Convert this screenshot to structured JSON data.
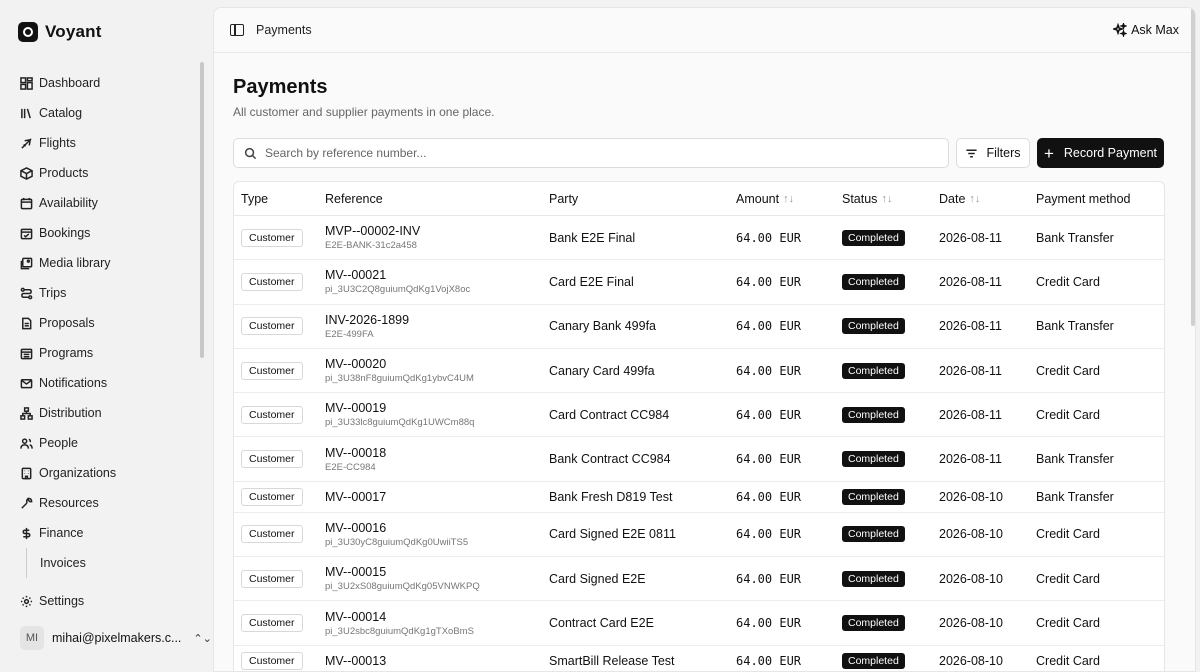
{
  "brand": {
    "name": "Voyant"
  },
  "sidebar": {
    "items": [
      {
        "label": "Dashboard",
        "icon": "dashboard-icon"
      },
      {
        "label": "Catalog",
        "icon": "catalog-icon"
      },
      {
        "label": "Flights",
        "icon": "plane-icon"
      },
      {
        "label": "Products",
        "icon": "box-icon"
      },
      {
        "label": "Availability",
        "icon": "calendar-icon"
      },
      {
        "label": "Bookings",
        "icon": "calendar-check-icon"
      },
      {
        "label": "Media library",
        "icon": "image-icon"
      },
      {
        "label": "Trips",
        "icon": "route-icon"
      },
      {
        "label": "Proposals",
        "icon": "document-icon"
      },
      {
        "label": "Programs",
        "icon": "calendar-grid-icon"
      },
      {
        "label": "Notifications",
        "icon": "mail-icon"
      },
      {
        "label": "Distribution",
        "icon": "network-icon"
      },
      {
        "label": "People",
        "icon": "people-icon"
      },
      {
        "label": "Organizations",
        "icon": "building-icon"
      },
      {
        "label": "Resources",
        "icon": "wrench-icon"
      },
      {
        "label": "Finance",
        "icon": "dollar-icon"
      }
    ],
    "subitem": "Invoices",
    "settings": "Settings",
    "user": {
      "initials": "MI",
      "email": "mihai@pixelmakers.c...",
      "chevron": "⌃⌄"
    }
  },
  "topbar": {
    "breadcrumb": "Payments",
    "ask_label": "Ask Max"
  },
  "page": {
    "title": "Payments",
    "subtitle": "All customer and supplier payments in one place.",
    "search_placeholder": "Search by reference number...",
    "filters_label": "Filters",
    "record_label": "Record Payment"
  },
  "table": {
    "headers": {
      "type": "Type",
      "reference": "Reference",
      "party": "Party",
      "amount": "Amount",
      "status": "Status",
      "date": "Date",
      "method": "Payment method"
    },
    "sort_glyph": "↑↓",
    "rows": [
      {
        "type": "Customer",
        "ref": "MVP--00002-INV",
        "sub": "E2E-BANK-31c2a458",
        "party": "Bank E2E Final",
        "amount": "64.00 EUR",
        "status": "Completed",
        "date": "2026-08-11",
        "method": "Bank Transfer"
      },
      {
        "type": "Customer",
        "ref": "MV--00021",
        "sub": "pi_3U3C2Q8guiumQdKg1VojX8oc",
        "party": "Card E2E Final",
        "amount": "64.00 EUR",
        "status": "Completed",
        "date": "2026-08-11",
        "method": "Credit Card"
      },
      {
        "type": "Customer",
        "ref": "INV-2026-1899",
        "sub": "E2E-499FA",
        "party": "Canary Bank 499fa",
        "amount": "64.00 EUR",
        "status": "Completed",
        "date": "2026-08-11",
        "method": "Bank Transfer"
      },
      {
        "type": "Customer",
        "ref": "MV--00020",
        "sub": "pi_3U38nF8guiumQdKg1ybvC4UM",
        "party": "Canary Card 499fa",
        "amount": "64.00 EUR",
        "status": "Completed",
        "date": "2026-08-11",
        "method": "Credit Card"
      },
      {
        "type": "Customer",
        "ref": "MV--00019",
        "sub": "pi_3U33lc8guiumQdKg1UWCm88q",
        "party": "Card Contract CC984",
        "amount": "64.00 EUR",
        "status": "Completed",
        "date": "2026-08-11",
        "method": "Credit Card"
      },
      {
        "type": "Customer",
        "ref": "MV--00018",
        "sub": "E2E-CC984",
        "party": "Bank Contract CC984",
        "amount": "64.00 EUR",
        "status": "Completed",
        "date": "2026-08-11",
        "method": "Bank Transfer"
      },
      {
        "type": "Customer",
        "ref": "MV--00017",
        "sub": "",
        "party": "Bank Fresh D819 Test",
        "amount": "64.00 EUR",
        "status": "Completed",
        "date": "2026-08-10",
        "method": "Bank Transfer"
      },
      {
        "type": "Customer",
        "ref": "MV--00016",
        "sub": "pi_3U30yC8guiumQdKg0UwiiTS5",
        "party": "Card Signed E2E 0811",
        "amount": "64.00 EUR",
        "status": "Completed",
        "date": "2026-08-10",
        "method": "Credit Card"
      },
      {
        "type": "Customer",
        "ref": "MV--00015",
        "sub": "pi_3U2xS08guiumQdKg05VNWKPQ",
        "party": "Card Signed E2E",
        "amount": "64.00 EUR",
        "status": "Completed",
        "date": "2026-08-10",
        "method": "Credit Card"
      },
      {
        "type": "Customer",
        "ref": "MV--00014",
        "sub": "pi_3U2sbc8guiumQdKg1gTXoBmS",
        "party": "Contract Card E2E",
        "amount": "64.00 EUR",
        "status": "Completed",
        "date": "2026-08-10",
        "method": "Credit Card"
      },
      {
        "type": "Customer",
        "ref": "MV--00013",
        "sub": "",
        "party": "SmartBill Release Test",
        "amount": "64.00 EUR",
        "status": "Completed",
        "date": "2026-08-10",
        "method": "Credit Card"
      }
    ]
  }
}
